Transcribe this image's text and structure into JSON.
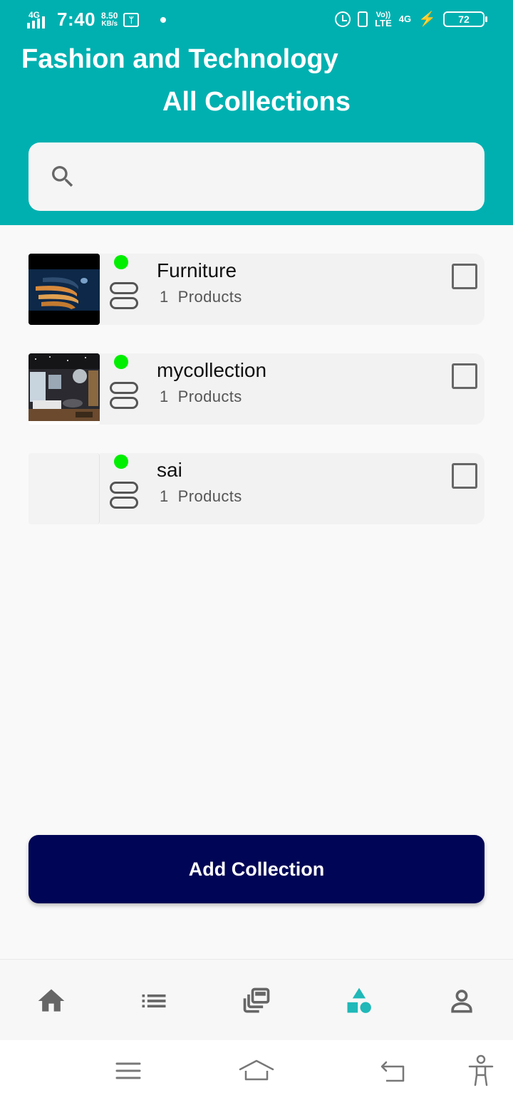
{
  "status_bar": {
    "network": "4G",
    "time": "7:40",
    "speed_value": "8.50",
    "speed_unit": "KB/s",
    "volte_top": "Vo))",
    "volte_bottom": "LTE",
    "network_right": "4G",
    "battery": "72"
  },
  "header": {
    "app_title": "Fashion and Technology",
    "page_title": "All Collections",
    "bg_color": "#00b0b0"
  },
  "search": {
    "value": "",
    "placeholder": ""
  },
  "collections": [
    {
      "name": "Furniture",
      "product_count": "1",
      "products_label": "Products",
      "active": true,
      "checked": false
    },
    {
      "name": "mycollection",
      "product_count": "1",
      "products_label": "Products",
      "active": true,
      "checked": false
    },
    {
      "name": "sai",
      "product_count": "1",
      "products_label": "Products",
      "active": true,
      "checked": false
    }
  ],
  "add_button": {
    "label": "Add Collection",
    "color": "#000555"
  },
  "tabbar": {
    "items": [
      {
        "icon": "home-icon",
        "active": false
      },
      {
        "icon": "list-icon",
        "active": false
      },
      {
        "icon": "gallery-icon",
        "active": false
      },
      {
        "icon": "shapes-icon",
        "active": true
      },
      {
        "icon": "profile-icon",
        "active": false
      }
    ],
    "active_color": "#20b8b8",
    "inactive_color": "#666666"
  },
  "system_nav": {
    "items": [
      "menu-icon",
      "home-outline-icon",
      "back-icon",
      "accessibility-icon"
    ]
  }
}
